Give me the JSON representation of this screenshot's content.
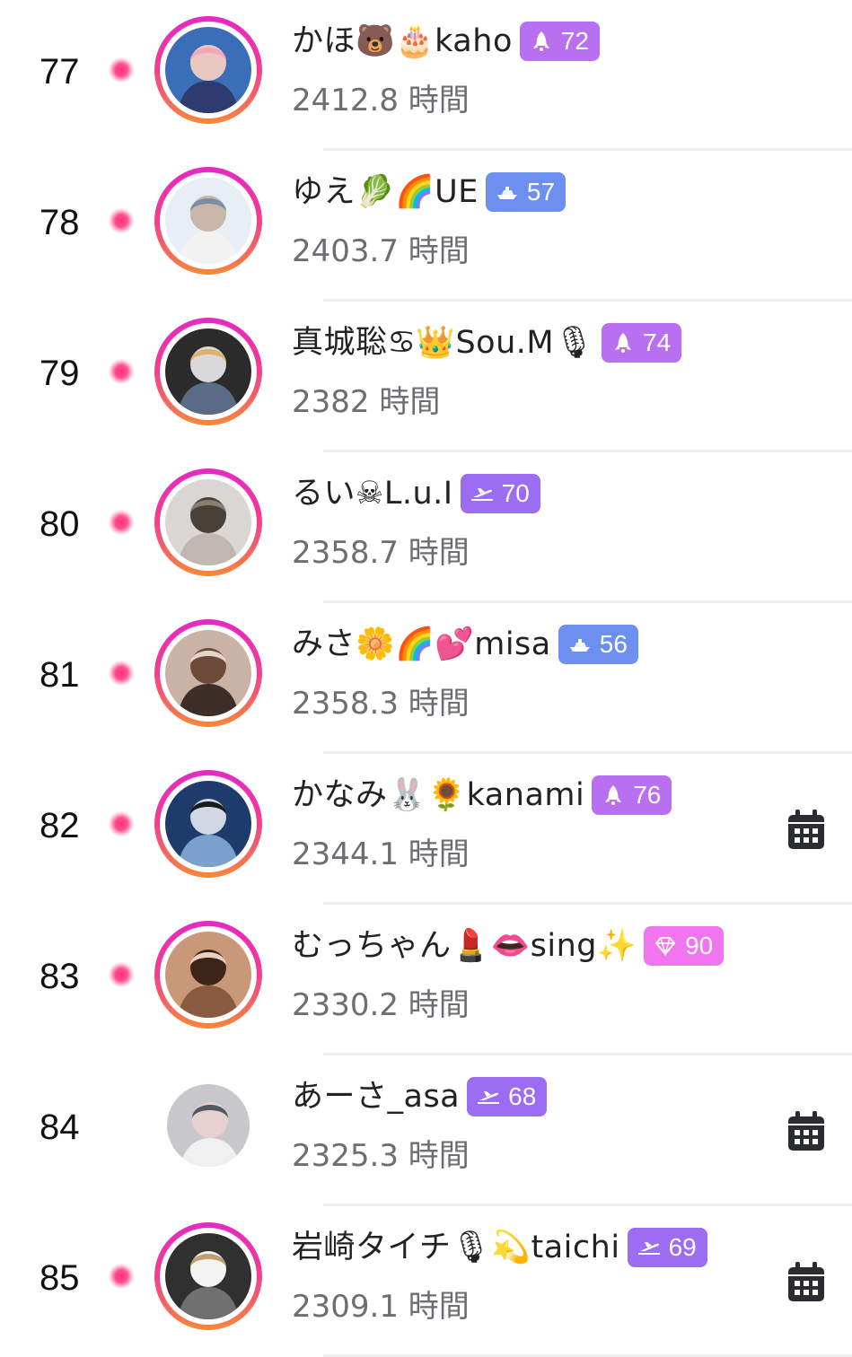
{
  "colors": {
    "rocket_badge": "#b870f0",
    "boat_badge": "#6c8ff0",
    "plane_badge": "#9c6cf2",
    "diamond_badge": "#f075ef",
    "live_dot": "#ff3b7f",
    "ring_top": "#e528c6",
    "ring_bottom": "#f7883a",
    "hours_text": "#6d6d72",
    "calendar_icon": "#2b2b34"
  },
  "rows": [
    {
      "rank": "77",
      "name": "かほ🐻🎂kaho",
      "badge_icon": "rocket-icon",
      "badge_type": "rocket",
      "badge_value": "72",
      "hours": "2412.8 時間",
      "has_calendar": false,
      "ring": true
    },
    {
      "rank": "78",
      "name": "ゆえ🥬🌈UE",
      "badge_icon": "boat-icon",
      "badge_type": "boat",
      "badge_value": "57",
      "hours": "2403.7 時間",
      "has_calendar": false,
      "ring": true
    },
    {
      "rank": "79",
      "name": "真城聡♋👑Sou.M🎙",
      "badge_icon": "rocket-icon",
      "badge_type": "rocket",
      "badge_value": "74",
      "hours": "2382 時間",
      "has_calendar": false,
      "ring": true
    },
    {
      "rank": "80",
      "name": "るい☠L.u.I",
      "badge_icon": "plane-icon",
      "badge_type": "plane",
      "badge_value": "70",
      "hours": "2358.7 時間",
      "has_calendar": false,
      "ring": true
    },
    {
      "rank": "81",
      "name": "みさ🌼🌈💕misa",
      "badge_icon": "boat-icon",
      "badge_type": "boat",
      "badge_value": "56",
      "hours": "2358.3 時間",
      "has_calendar": false,
      "ring": true
    },
    {
      "rank": "82",
      "name": "かなみ🐰🌻kanami",
      "badge_icon": "rocket-icon",
      "badge_type": "rocket",
      "badge_value": "76",
      "hours": "2344.1 時間",
      "has_calendar": true,
      "ring": true
    },
    {
      "rank": "83",
      "name": "むっちゃん💄👄sing✨",
      "badge_icon": "diamond-icon",
      "badge_type": "diamond",
      "badge_value": "90",
      "hours": "2330.2 時間",
      "has_calendar": false,
      "ring": true
    },
    {
      "rank": "84",
      "name": "あーさ_asa",
      "badge_icon": "plane-icon",
      "badge_type": "plane",
      "badge_value": "68",
      "hours": "2325.3 時間",
      "has_calendar": true,
      "ring": false
    },
    {
      "rank": "85",
      "name": "岩崎タイチ🎙💫taichi",
      "badge_icon": "plane-icon",
      "badge_type": "plane",
      "badge_value": "69",
      "hours": "2309.1 時間",
      "has_calendar": true,
      "ring": true
    }
  ]
}
